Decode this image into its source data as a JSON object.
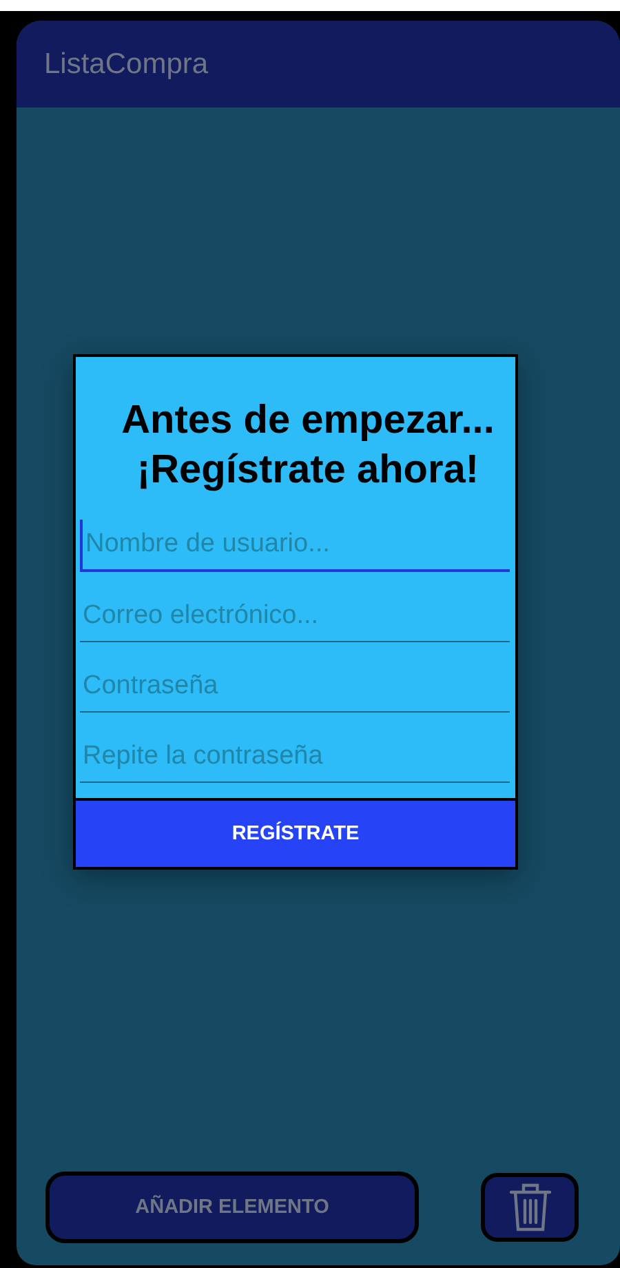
{
  "app_bar": {
    "title": "ListaCompra"
  },
  "dialog": {
    "title": "Antes de empezar... ¡Regístrate ahora!",
    "fields": [
      {
        "placeholder": "Nombre de usuario...",
        "focused": true
      },
      {
        "placeholder": "Correo electrónico...",
        "focused": false
      },
      {
        "placeholder": "Contraseña",
        "focused": false
      },
      {
        "placeholder": "Repite la contraseña",
        "focused": false
      }
    ],
    "button": "REGÍSTRATE"
  },
  "bottom_bar": {
    "add_button": "AÑADIR ELEMENTO"
  }
}
